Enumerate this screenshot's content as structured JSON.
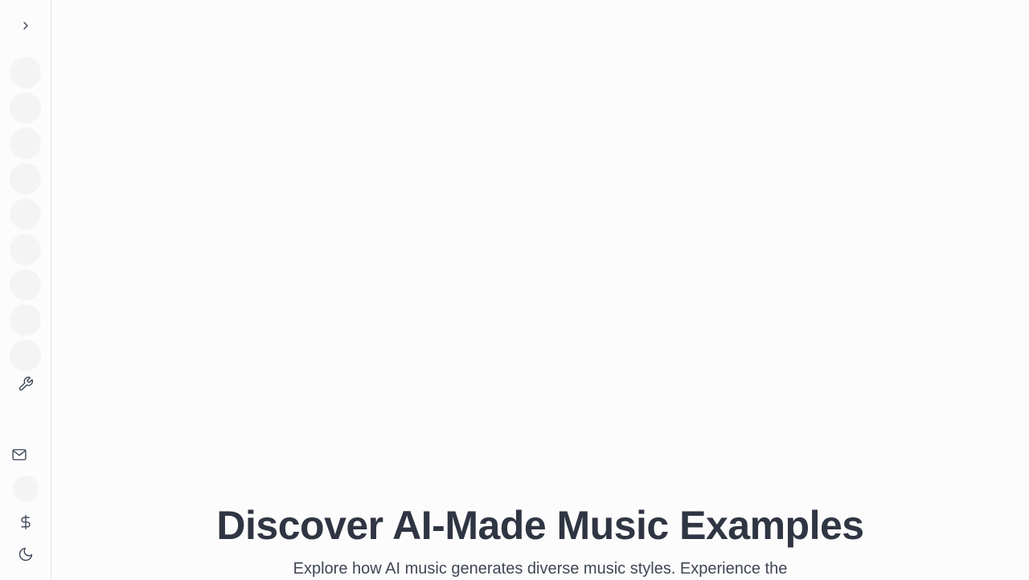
{
  "sidebar": {
    "expand_icon": "chevron-right-icon",
    "nav_placeholder_count": 9,
    "tools_icon": "wrench-icon",
    "contact_icon": "mail-icon",
    "pricing_icon": "dollar-icon",
    "theme_icon": "moon-icon"
  },
  "main": {
    "title": "Discover AI-Made Music Examples",
    "subtitle": "Explore how AI music generates diverse music styles. Experience the"
  },
  "colors": {
    "background": "#fcfcfc",
    "heading": "#2f3542",
    "placeholder": "#f4f4f4"
  }
}
